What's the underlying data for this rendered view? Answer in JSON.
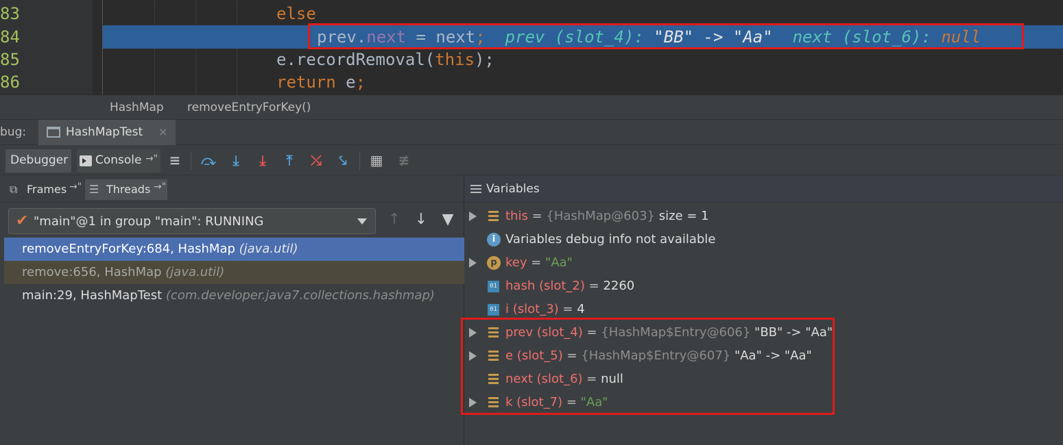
{
  "editor": {
    "lines": [
      {
        "num": "83",
        "code": [
          {
            "t": "else",
            "c": "kw"
          }
        ]
      },
      {
        "num": "84",
        "code": [
          {
            "t": "prev.",
            "c": ""
          },
          {
            "t": "next",
            "c": "field"
          },
          {
            "t": " = next",
            "c": ""
          },
          {
            "t": ";",
            "c": "kw"
          },
          {
            "t": "  prev (slot_4): ",
            "c": "inlay"
          },
          {
            "t": "\"BB\" -> \"Aa\"",
            "c": "inlay-str"
          },
          {
            "t": "  next (slot_6): ",
            "c": "inlay"
          },
          {
            "t": "null",
            "c": "inlay-null"
          }
        ]
      },
      {
        "num": "85",
        "code": [
          {
            "t": "e.recordRemoval(",
            "c": ""
          },
          {
            "t": "this",
            "c": "kw"
          },
          {
            "t": ");",
            "c": ""
          }
        ]
      },
      {
        "num": "86",
        "code": [
          {
            "t": "return",
            "c": "kw"
          },
          {
            "t": " e",
            "c": ""
          },
          {
            "t": ";",
            "c": "kw"
          }
        ]
      }
    ]
  },
  "breadcrumb": {
    "class_name": "HashMap",
    "method_name": "removeEntryForKey()"
  },
  "debug": {
    "label": "bug:",
    "session_tab": "HashMapTest",
    "close_glyph": "×",
    "tab_debugger": "Debugger",
    "tab_console": "Console",
    "pin_glyph": "→\""
  },
  "frames": {
    "tab_frames": "Frames",
    "tab_threads": "Threads",
    "thread_selected": "\"main\"@1 in group \"main\": RUNNING",
    "rows": [
      {
        "method": "removeEntryForKey:684, HashMap ",
        "pkg": "(java.util)"
      },
      {
        "method": "remove:656, HashMap ",
        "pkg": "(java.util)"
      },
      {
        "method": "main:29, HashMapTest ",
        "pkg": "(com.developer.java7.collections.hashmap)"
      }
    ]
  },
  "variables": {
    "title": "Variables",
    "rows": [
      {
        "name": "this",
        "eq": " = ",
        "ref": "{HashMap@603}",
        "val": "  size = 1",
        "str": ""
      },
      {
        "name": "",
        "eq": "",
        "ref": "",
        "val": "Variables debug info not available",
        "str": ""
      },
      {
        "name": "key",
        "eq": " = ",
        "ref": "",
        "val": "",
        "str": "\"Aa\""
      },
      {
        "name": "hash (slot_2)",
        "eq": " = ",
        "ref": "",
        "val": "2260",
        "str": ""
      },
      {
        "name": "i (slot_3)",
        "eq": " = ",
        "ref": "",
        "val": "4",
        "str": ""
      },
      {
        "name": "prev (slot_4)",
        "eq": " = ",
        "ref": "{HashMap$Entry@606}",
        "val": " \"BB\" -> \"Aa\"",
        "str": ""
      },
      {
        "name": "e (slot_5)",
        "eq": " = ",
        "ref": "{HashMap$Entry@607}",
        "val": " \"Aa\" -> \"Aa\"",
        "str": ""
      },
      {
        "name": "next (slot_6)",
        "eq": " = ",
        "ref": "",
        "val": "null",
        "str": ""
      },
      {
        "name": "k (slot_7)",
        "eq": " = ",
        "ref": "",
        "val": "",
        "str": "\"Aa\""
      }
    ]
  },
  "colors": {
    "highlight": "#2d5f99",
    "selected_frame": "#4b6eaf",
    "caller_frame": "#4d4a3c",
    "annotation_box": "#e01b1b"
  }
}
